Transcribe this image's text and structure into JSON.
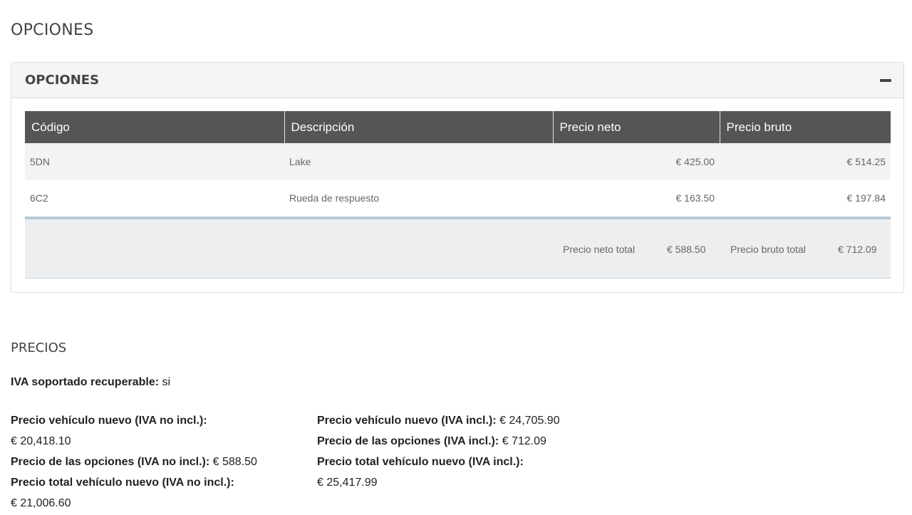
{
  "page_title": "OPCIONES",
  "panel": {
    "title": "OPCIONES",
    "collapse_icon": "minus-icon"
  },
  "table": {
    "headers": [
      "Código",
      "Descripción",
      "Precio neto",
      "Precio bruto"
    ],
    "rows": [
      {
        "code": "5DN",
        "description": "Lake",
        "net": "€ 425.00",
        "gross": "€ 514.25"
      },
      {
        "code": "6C2",
        "description": "Rueda de respuesto",
        "net": "€ 163.50",
        "gross": "€ 197.84"
      }
    ],
    "totals": {
      "net_label": "Precio neto total",
      "net_value": "€ 588.50",
      "gross_label": "Precio bruto total",
      "gross_value": "€ 712.09"
    }
  },
  "precios": {
    "title": "PRECIOS",
    "iva_label": "IVA soportado recuperable:",
    "iva_value": "si",
    "left": [
      {
        "label": "Precio vehículo nuevo (IVA no incl.):",
        "value": "€ 20,418.10"
      },
      {
        "label": "Precio de las opciones (IVA no incl.):",
        "value": "€ 588.50"
      },
      {
        "label": "Precio total vehículo nuevo (IVA no incl.):",
        "value": "€ 21,006.60"
      }
    ],
    "right": [
      {
        "label": "Precio vehículo nuevo (IVA incl.):",
        "value": "€ 24,705.90"
      },
      {
        "label": "Precio de las opciones (IVA incl.):",
        "value": "€ 712.09"
      },
      {
        "label": "Precio total vehículo nuevo (IVA incl.):",
        "value": "€ 25,417.99"
      }
    ]
  }
}
